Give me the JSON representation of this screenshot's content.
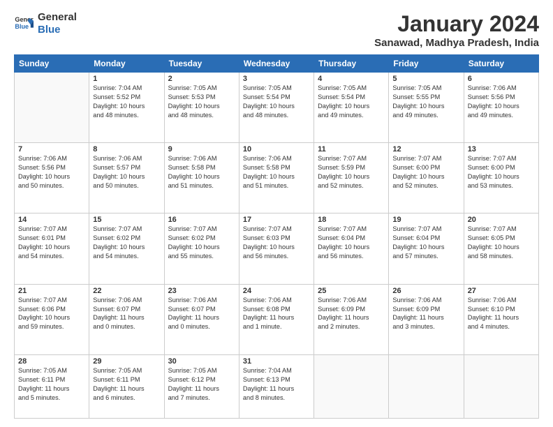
{
  "logo": {
    "line1": "General",
    "line2": "Blue"
  },
  "title": "January 2024",
  "subtitle": "Sanawad, Madhya Pradesh, India",
  "days_of_week": [
    "Sunday",
    "Monday",
    "Tuesday",
    "Wednesday",
    "Thursday",
    "Friday",
    "Saturday"
  ],
  "weeks": [
    [
      {
        "day": "",
        "info": ""
      },
      {
        "day": "1",
        "info": "Sunrise: 7:04 AM\nSunset: 5:52 PM\nDaylight: 10 hours\nand 48 minutes."
      },
      {
        "day": "2",
        "info": "Sunrise: 7:05 AM\nSunset: 5:53 PM\nDaylight: 10 hours\nand 48 minutes."
      },
      {
        "day": "3",
        "info": "Sunrise: 7:05 AM\nSunset: 5:54 PM\nDaylight: 10 hours\nand 48 minutes."
      },
      {
        "day": "4",
        "info": "Sunrise: 7:05 AM\nSunset: 5:54 PM\nDaylight: 10 hours\nand 49 minutes."
      },
      {
        "day": "5",
        "info": "Sunrise: 7:05 AM\nSunset: 5:55 PM\nDaylight: 10 hours\nand 49 minutes."
      },
      {
        "day": "6",
        "info": "Sunrise: 7:06 AM\nSunset: 5:56 PM\nDaylight: 10 hours\nand 49 minutes."
      }
    ],
    [
      {
        "day": "7",
        "info": "Sunrise: 7:06 AM\nSunset: 5:56 PM\nDaylight: 10 hours\nand 50 minutes."
      },
      {
        "day": "8",
        "info": "Sunrise: 7:06 AM\nSunset: 5:57 PM\nDaylight: 10 hours\nand 50 minutes."
      },
      {
        "day": "9",
        "info": "Sunrise: 7:06 AM\nSunset: 5:58 PM\nDaylight: 10 hours\nand 51 minutes."
      },
      {
        "day": "10",
        "info": "Sunrise: 7:06 AM\nSunset: 5:58 PM\nDaylight: 10 hours\nand 51 minutes."
      },
      {
        "day": "11",
        "info": "Sunrise: 7:07 AM\nSunset: 5:59 PM\nDaylight: 10 hours\nand 52 minutes."
      },
      {
        "day": "12",
        "info": "Sunrise: 7:07 AM\nSunset: 6:00 PM\nDaylight: 10 hours\nand 52 minutes."
      },
      {
        "day": "13",
        "info": "Sunrise: 7:07 AM\nSunset: 6:00 PM\nDaylight: 10 hours\nand 53 minutes."
      }
    ],
    [
      {
        "day": "14",
        "info": "Sunrise: 7:07 AM\nSunset: 6:01 PM\nDaylight: 10 hours\nand 54 minutes."
      },
      {
        "day": "15",
        "info": "Sunrise: 7:07 AM\nSunset: 6:02 PM\nDaylight: 10 hours\nand 54 minutes."
      },
      {
        "day": "16",
        "info": "Sunrise: 7:07 AM\nSunset: 6:02 PM\nDaylight: 10 hours\nand 55 minutes."
      },
      {
        "day": "17",
        "info": "Sunrise: 7:07 AM\nSunset: 6:03 PM\nDaylight: 10 hours\nand 56 minutes."
      },
      {
        "day": "18",
        "info": "Sunrise: 7:07 AM\nSunset: 6:04 PM\nDaylight: 10 hours\nand 56 minutes."
      },
      {
        "day": "19",
        "info": "Sunrise: 7:07 AM\nSunset: 6:04 PM\nDaylight: 10 hours\nand 57 minutes."
      },
      {
        "day": "20",
        "info": "Sunrise: 7:07 AM\nSunset: 6:05 PM\nDaylight: 10 hours\nand 58 minutes."
      }
    ],
    [
      {
        "day": "21",
        "info": "Sunrise: 7:07 AM\nSunset: 6:06 PM\nDaylight: 10 hours\nand 59 minutes."
      },
      {
        "day": "22",
        "info": "Sunrise: 7:06 AM\nSunset: 6:07 PM\nDaylight: 11 hours\nand 0 minutes."
      },
      {
        "day": "23",
        "info": "Sunrise: 7:06 AM\nSunset: 6:07 PM\nDaylight: 11 hours\nand 0 minutes."
      },
      {
        "day": "24",
        "info": "Sunrise: 7:06 AM\nSunset: 6:08 PM\nDaylight: 11 hours\nand 1 minute."
      },
      {
        "day": "25",
        "info": "Sunrise: 7:06 AM\nSunset: 6:09 PM\nDaylight: 11 hours\nand 2 minutes."
      },
      {
        "day": "26",
        "info": "Sunrise: 7:06 AM\nSunset: 6:09 PM\nDaylight: 11 hours\nand 3 minutes."
      },
      {
        "day": "27",
        "info": "Sunrise: 7:06 AM\nSunset: 6:10 PM\nDaylight: 11 hours\nand 4 minutes."
      }
    ],
    [
      {
        "day": "28",
        "info": "Sunrise: 7:05 AM\nSunset: 6:11 PM\nDaylight: 11 hours\nand 5 minutes."
      },
      {
        "day": "29",
        "info": "Sunrise: 7:05 AM\nSunset: 6:11 PM\nDaylight: 11 hours\nand 6 minutes."
      },
      {
        "day": "30",
        "info": "Sunrise: 7:05 AM\nSunset: 6:12 PM\nDaylight: 11 hours\nand 7 minutes."
      },
      {
        "day": "31",
        "info": "Sunrise: 7:04 AM\nSunset: 6:13 PM\nDaylight: 11 hours\nand 8 minutes."
      },
      {
        "day": "",
        "info": ""
      },
      {
        "day": "",
        "info": ""
      },
      {
        "day": "",
        "info": ""
      }
    ]
  ]
}
